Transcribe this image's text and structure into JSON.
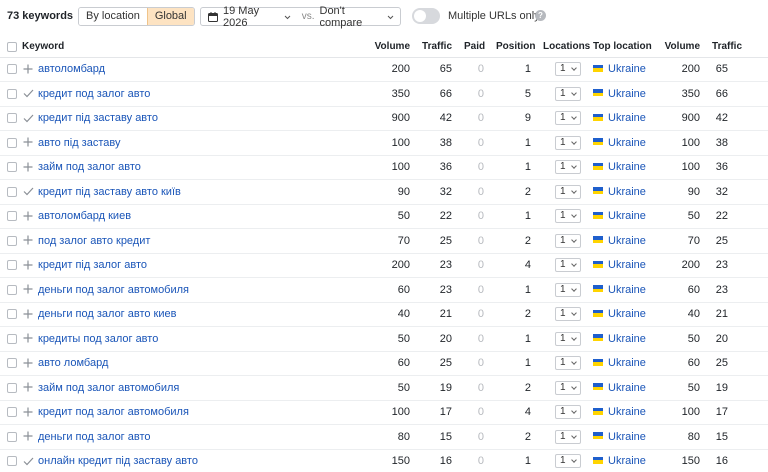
{
  "toolbar": {
    "keyword_count": "73 keywords",
    "by_location": "By location",
    "global": "Global",
    "date": "19 May 2026",
    "vs": "vs.",
    "compare": "Don't compare",
    "multiple_urls": "Multiple URLs only",
    "help": "?"
  },
  "colors": {
    "link": "#1a55b8",
    "active_segment": "#fde3c2",
    "flag_blue": "#1f5fcc",
    "flag_yellow": "#ffd400"
  },
  "columns": [
    "Keyword",
    "Volume",
    "Traffic",
    "Paid",
    "Position",
    "Locations",
    "Top location",
    "Volume",
    "Traffic"
  ],
  "rows": [
    {
      "action": "plus",
      "keyword": "автоломбард",
      "volume": "200",
      "traffic": "65",
      "paid": "0",
      "position": "1",
      "locations": "1",
      "top_location": "Ukraine",
      "loc_volume": "200",
      "loc_traffic": "65"
    },
    {
      "action": "check",
      "keyword": "кредит под залог авто",
      "volume": "350",
      "traffic": "66",
      "paid": "0",
      "position": "5",
      "locations": "1",
      "top_location": "Ukraine",
      "loc_volume": "350",
      "loc_traffic": "66"
    },
    {
      "action": "check",
      "keyword": "кредит під заставу авто",
      "volume": "900",
      "traffic": "42",
      "paid": "0",
      "position": "9",
      "locations": "1",
      "top_location": "Ukraine",
      "loc_volume": "900",
      "loc_traffic": "42"
    },
    {
      "action": "plus",
      "keyword": "авто під заставу",
      "volume": "100",
      "traffic": "38",
      "paid": "0",
      "position": "1",
      "locations": "1",
      "top_location": "Ukraine",
      "loc_volume": "100",
      "loc_traffic": "38"
    },
    {
      "action": "plus",
      "keyword": "займ под залог авто",
      "volume": "100",
      "traffic": "36",
      "paid": "0",
      "position": "1",
      "locations": "1",
      "top_location": "Ukraine",
      "loc_volume": "100",
      "loc_traffic": "36"
    },
    {
      "action": "check",
      "keyword": "кредит під заставу авто київ",
      "volume": "90",
      "traffic": "32",
      "paid": "0",
      "position": "2",
      "locations": "1",
      "top_location": "Ukraine",
      "loc_volume": "90",
      "loc_traffic": "32"
    },
    {
      "action": "plus",
      "keyword": "автоломбард киев",
      "volume": "50",
      "traffic": "22",
      "paid": "0",
      "position": "1",
      "locations": "1",
      "top_location": "Ukraine",
      "loc_volume": "50",
      "loc_traffic": "22"
    },
    {
      "action": "plus",
      "keyword": "под залог авто кредит",
      "volume": "70",
      "traffic": "25",
      "paid": "0",
      "position": "2",
      "locations": "1",
      "top_location": "Ukraine",
      "loc_volume": "70",
      "loc_traffic": "25"
    },
    {
      "action": "plus",
      "keyword": "кредит під залог авто",
      "volume": "200",
      "traffic": "23",
      "paid": "0",
      "position": "4",
      "locations": "1",
      "top_location": "Ukraine",
      "loc_volume": "200",
      "loc_traffic": "23"
    },
    {
      "action": "plus",
      "keyword": "деньги под залог автомобиля",
      "volume": "60",
      "traffic": "23",
      "paid": "0",
      "position": "1",
      "locations": "1",
      "top_location": "Ukraine",
      "loc_volume": "60",
      "loc_traffic": "23"
    },
    {
      "action": "plus",
      "keyword": "деньги под залог авто киев",
      "volume": "40",
      "traffic": "21",
      "paid": "0",
      "position": "2",
      "locations": "1",
      "top_location": "Ukraine",
      "loc_volume": "40",
      "loc_traffic": "21"
    },
    {
      "action": "plus",
      "keyword": "кредиты под залог авто",
      "volume": "50",
      "traffic": "20",
      "paid": "0",
      "position": "1",
      "locations": "1",
      "top_location": "Ukraine",
      "loc_volume": "50",
      "loc_traffic": "20"
    },
    {
      "action": "plus",
      "keyword": "авто ломбард",
      "volume": "60",
      "traffic": "25",
      "paid": "0",
      "position": "1",
      "locations": "1",
      "top_location": "Ukraine",
      "loc_volume": "60",
      "loc_traffic": "25"
    },
    {
      "action": "plus",
      "keyword": "займ под залог автомобиля",
      "volume": "50",
      "traffic": "19",
      "paid": "0",
      "position": "2",
      "locations": "1",
      "top_location": "Ukraine",
      "loc_volume": "50",
      "loc_traffic": "19"
    },
    {
      "action": "plus",
      "keyword": "кредит под залог автомобиля",
      "volume": "100",
      "traffic": "17",
      "paid": "0",
      "position": "4",
      "locations": "1",
      "top_location": "Ukraine",
      "loc_volume": "100",
      "loc_traffic": "17"
    },
    {
      "action": "plus",
      "keyword": "деньги под залог авто",
      "volume": "80",
      "traffic": "15",
      "paid": "0",
      "position": "2",
      "locations": "1",
      "top_location": "Ukraine",
      "loc_volume": "80",
      "loc_traffic": "15"
    },
    {
      "action": "check",
      "keyword": "онлайн кредит під заставу авто",
      "volume": "150",
      "traffic": "16",
      "paid": "0",
      "position": "1",
      "locations": "1",
      "top_location": "Ukraine",
      "loc_volume": "150",
      "loc_traffic": "16"
    }
  ]
}
